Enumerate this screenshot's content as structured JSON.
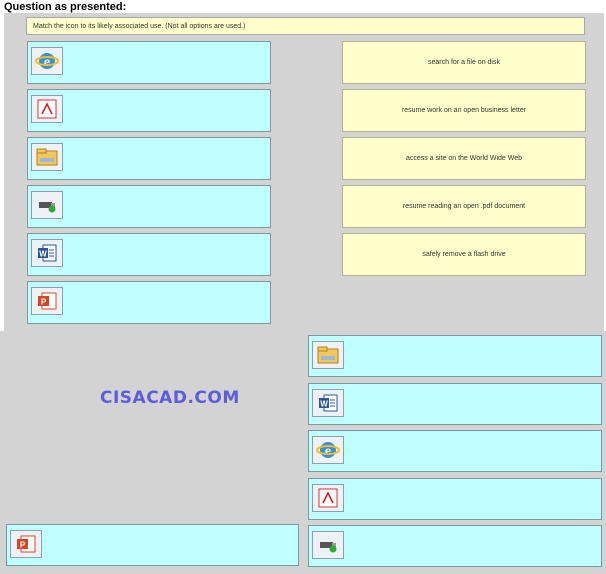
{
  "heading": "Question as presented:",
  "instruction": "Match the icon to its likely associated use. (Not all options are used.)",
  "source_icons": [
    {
      "icon": "internet-explorer-icon"
    },
    {
      "icon": "pdf-reader-icon"
    },
    {
      "icon": "file-explorer-icon"
    },
    {
      "icon": "safely-remove-hardware-icon"
    },
    {
      "icon": "word-document-icon"
    },
    {
      "icon": "powerpoint-icon"
    }
  ],
  "uses": [
    "search for a file on disk",
    "resume work on an open business letter",
    "access a site on the World Wide Web",
    "resume reading an open .pdf document",
    "safely remove a flash drive"
  ],
  "answer_icons": [
    {
      "icon": "file-explorer-icon"
    },
    {
      "icon": "word-document-icon"
    },
    {
      "icon": "internet-explorer-icon"
    },
    {
      "icon": "pdf-reader-icon"
    },
    {
      "icon": "safely-remove-hardware-icon"
    }
  ],
  "unused_icon": {
    "icon": "powerpoint-icon"
  },
  "watermark": "CISACAD.COM"
}
